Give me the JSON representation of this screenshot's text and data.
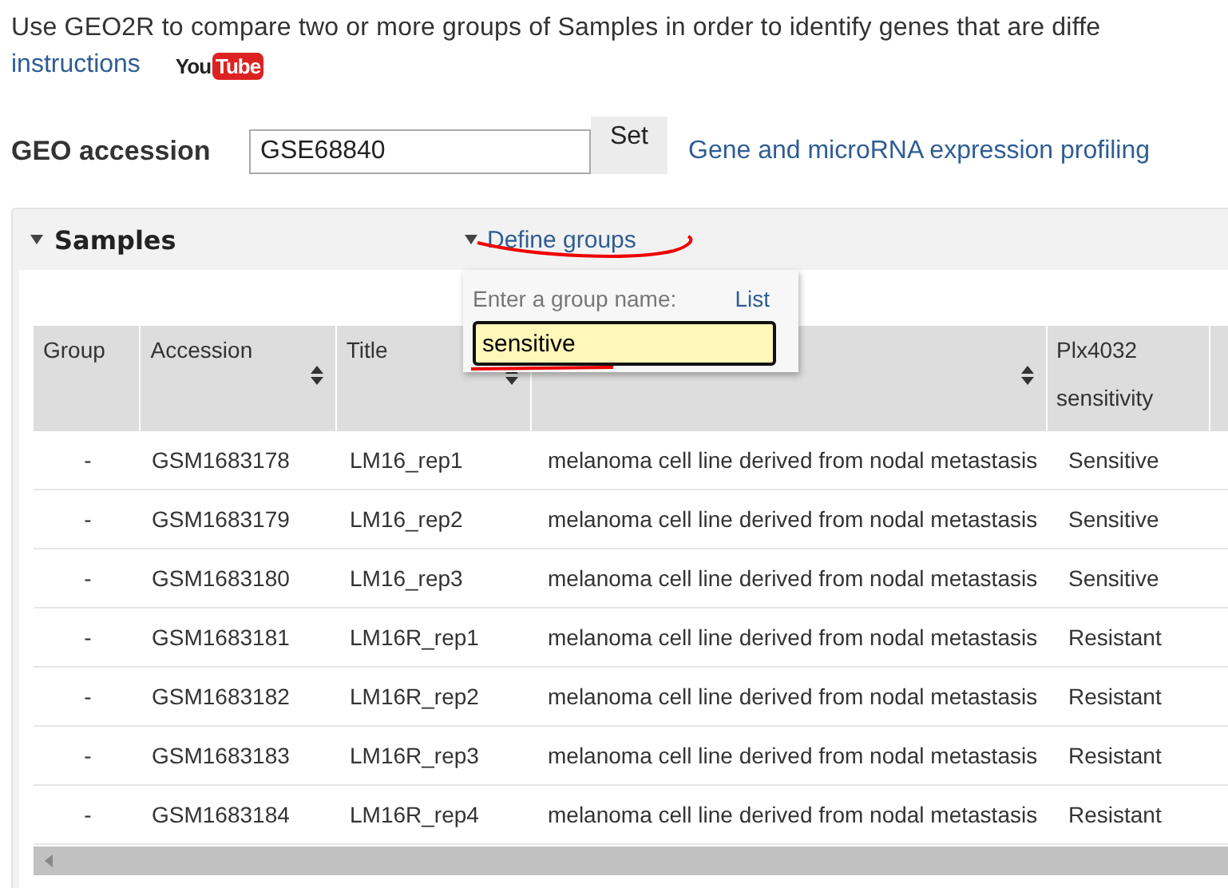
{
  "intro": {
    "text": "Use GEO2R to compare two or more groups of Samples in order to identify genes that are diffe",
    "link": "instructions",
    "logo": {
      "left": "You",
      "right": "Tube"
    }
  },
  "accession": {
    "label": "GEO accession",
    "value": "GSE68840",
    "button": "Set",
    "title_link": "Gene and microRNA expression profiling"
  },
  "samples": {
    "title": "Samples",
    "expanded": true,
    "define_groups": "Define groups",
    "popup": {
      "prompt": "Enter a group name:",
      "list_link": "List",
      "value": "sensitive"
    },
    "columns": [
      {
        "label": "Group",
        "sortable": false
      },
      {
        "label": "Accession",
        "sortable": true
      },
      {
        "label": "Title",
        "sortable": true
      },
      {
        "sortable": true
      },
      {
        "label": "Plx4032 sensitivity",
        "sortable": false
      },
      {
        "sortable": false
      }
    ],
    "rows": [
      [
        "-",
        "GSM1683178",
        "LM16_rep1",
        "melanoma cell line derived from nodal metastasis",
        "Sensitive"
      ],
      [
        "-",
        "GSM1683179",
        "LM16_rep2",
        "melanoma cell line derived from nodal metastasis",
        "Sensitive"
      ],
      [
        "-",
        "GSM1683180",
        "LM16_rep3",
        "melanoma cell line derived from nodal metastasis",
        "Sensitive"
      ],
      [
        "-",
        "GSM1683181",
        "LM16R_rep1",
        "melanoma cell line derived from nodal metastasis",
        "Resistant"
      ],
      [
        "-",
        "GSM1683182",
        "LM16R_rep2",
        "melanoma cell line derived from nodal metastasis",
        "Resistant"
      ],
      [
        "-",
        "GSM1683183",
        "LM16R_rep3",
        "melanoma cell line derived from nodal metastasis",
        "Resistant"
      ],
      [
        "-",
        "GSM1683184",
        "LM16R_rep4",
        "melanoma cell line derived from nodal metastasis",
        "Resistant"
      ]
    ]
  }
}
